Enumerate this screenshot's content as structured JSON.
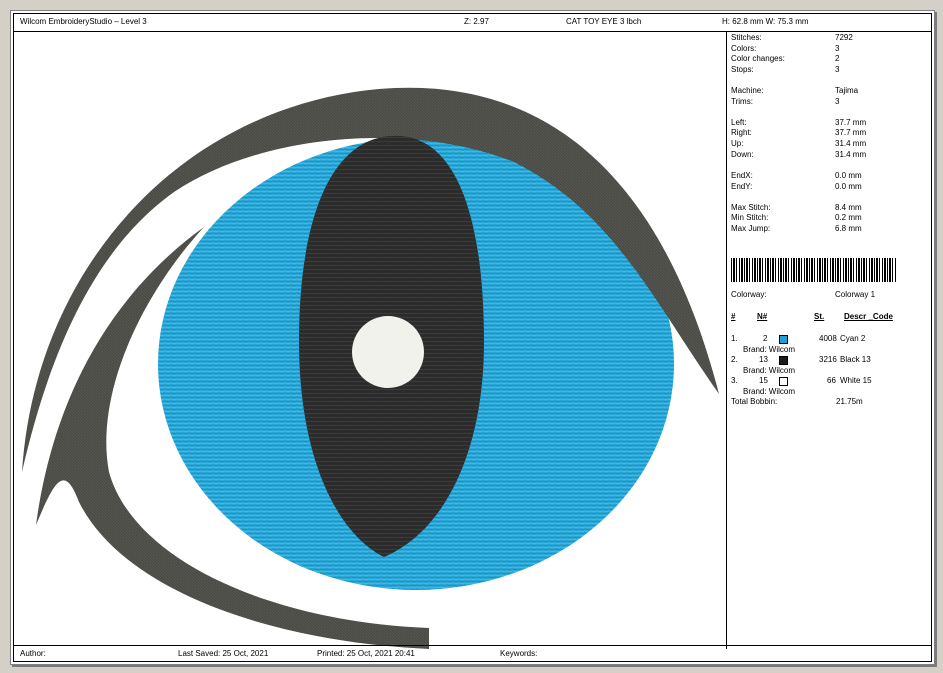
{
  "header": {
    "app_title": "Wilcom EmbroideryStudio – Level 3",
    "zoom": "Z: 2.97",
    "design_name": "CAT TOY EYE 3 lbch",
    "dimensions": "H: 62.8 mm   W: 75.3 mm"
  },
  "stats": {
    "stitches_label": "Stitches:",
    "stitches": "7292",
    "colors_label": "Colors:",
    "colors": "3",
    "color_changes_label": "Color changes:",
    "color_changes": "2",
    "stops_label": "Stops:",
    "stops": "3",
    "machine_label": "Machine:",
    "machine": "Tajima",
    "trims_label": "Trims:",
    "trims": "3",
    "left_label": "Left:",
    "left": "37.7 mm",
    "right_label": "Right:",
    "right": "37.7 mm",
    "up_label": "Up:",
    "up": "31.4 mm",
    "down_label": "Down:",
    "down": "31.4 mm",
    "endx_label": "EndX:",
    "endx": "0.0 mm",
    "endy_label": "EndY:",
    "endy": "0.0 mm",
    "max_stitch_label": "Max Stitch:",
    "max_stitch": "8.4 mm",
    "min_stitch_label": "Min Stitch:",
    "min_stitch": "0.2 mm",
    "max_jump_label": "Max Jump:",
    "max_jump": "6.8 mm"
  },
  "colorway": {
    "label": "Colorway:",
    "value": "Colorway 1"
  },
  "color_table": {
    "headers": {
      "num": "#",
      "n": "N#",
      "st": "St.",
      "descr": "Descr _Code"
    },
    "rows": [
      {
        "num": "1.",
        "n": "2",
        "color": "#1e9fd6",
        "st": "4008",
        "descr": "Cyan 2",
        "brand": "Brand: Wilcom"
      },
      {
        "num": "2.",
        "n": "13",
        "color": "#1a1a1a",
        "st": "3216",
        "descr": "Black 13",
        "brand": "Brand: Wilcom"
      },
      {
        "num": "3.",
        "n": "15",
        "color": "#ffffff",
        "st": "66",
        "descr": "White 15",
        "brand": "Brand: Wilcom"
      }
    ],
    "total_bobbin_label": "Total Bobbin:",
    "total_bobbin": "21.75m"
  },
  "footer": {
    "author": "Author:",
    "last_saved": "Last Saved: 25 Oct, 2021",
    "printed": "Printed:  25 Oct, 2021 20:41",
    "keywords": "Keywords:"
  },
  "design_colors": {
    "iris": "#2aa8d8",
    "pupil": "#2b2b2b",
    "lid": "#4a4a46",
    "highlight": "#f2f2ec"
  }
}
